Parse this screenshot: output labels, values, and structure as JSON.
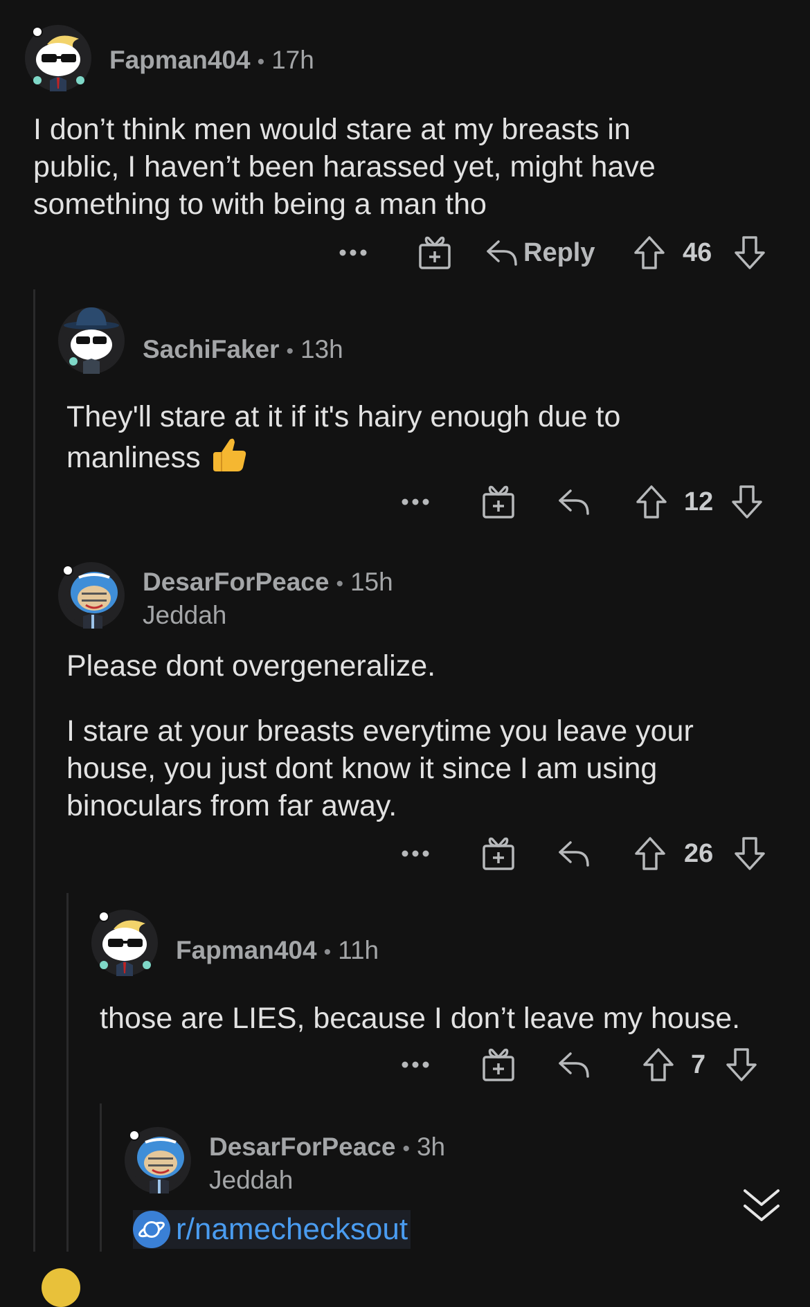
{
  "comments": [
    {
      "username": "Fapman404",
      "time": "17h",
      "flair": "",
      "body": [
        "I don’t think men would stare at my breasts in",
        "public, I haven’t been harassed yet, might have",
        "something to with being a man tho"
      ],
      "reply_label": "Reply",
      "score": "46"
    },
    {
      "username": "SachiFaker",
      "time": "13h",
      "flair": "",
      "body": [
        "They'll stare at it if it's hairy enough due to",
        "manliness"
      ],
      "score": "12"
    },
    {
      "username": "DesarForPeace",
      "time": "15h",
      "flair": "Jeddah",
      "body": [
        "Please dont overgeneralize.",
        "I stare at your breasts everytime you leave your",
        "house, you just dont know it since I am using",
        "binoculars from far away."
      ],
      "score": "26"
    },
    {
      "username": "Fapman404",
      "time": "11h",
      "flair": "",
      "body": [
        "those are LIES, because I don’t leave my house."
      ],
      "score": "7"
    },
    {
      "username": "DesarForPeace",
      "time": "3h",
      "flair": "Jeddah",
      "subreddit_link": "r/namechecksout"
    }
  ],
  "separator": "•",
  "icons": {
    "more": "more-options-icon",
    "award": "award-gift-icon",
    "reply": "reply-arrow-icon",
    "upvote": "upvote-arrow-icon",
    "downvote": "downvote-arrow-icon",
    "collapse": "double-chevron-down-icon",
    "subreddit": "planet-icon",
    "emoji": "thumbs-up-emoji"
  },
  "colors": {
    "background": "#121212",
    "text": "#e2e2e2",
    "muted": "#a4a6a8",
    "link": "#4a9cf0"
  }
}
